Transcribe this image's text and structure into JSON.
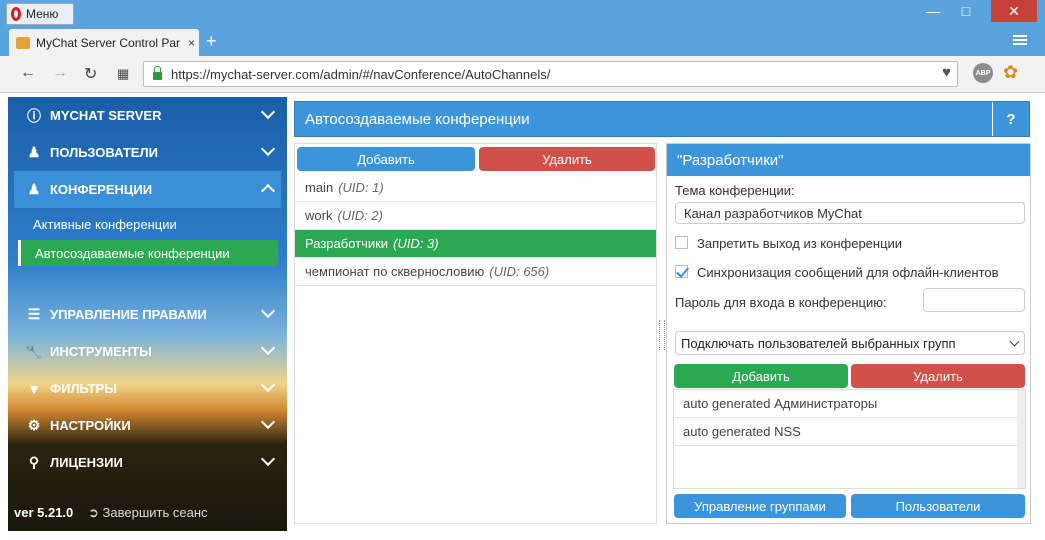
{
  "browser": {
    "menu_label": "Меню",
    "tab_title": "MyChat Server Control Par",
    "tab_close": "×",
    "new_tab": "+",
    "url": "https://mychat-server.com/admin/#/navConference/AutoChannels/",
    "abp_label": "ABP"
  },
  "sidebar": {
    "items": [
      {
        "label": "MYCHAT SERVER",
        "icon": "info-icon"
      },
      {
        "label": "ПОЛЬЗОВАТЕЛИ",
        "icon": "users-icon"
      },
      {
        "label": "КОНФЕРЕНЦИИ",
        "icon": "users-icon"
      },
      {
        "label": "УПРАВЛЕНИЕ ПРАВАМИ",
        "icon": "list-icon"
      },
      {
        "label": "ИНСТРУМЕНТЫ",
        "icon": "wrench-icon"
      },
      {
        "label": "ФИЛЬТРЫ",
        "icon": "filter-icon"
      },
      {
        "label": "НАСТРОЙКИ",
        "icon": "gears-icon"
      },
      {
        "label": "ЛИЦЕНЗИИ",
        "icon": "key-icon"
      }
    ],
    "sub_items": [
      "Активные конференции",
      "Автосоздаваемые конференции"
    ],
    "version": "ver 5.21.0",
    "logout": "Завершить сеанс"
  },
  "header": {
    "title": "Автосоздаваемые конференции",
    "help": "?"
  },
  "conferences": {
    "add_label": "Добавить",
    "delete_label": "Удалить",
    "rows": [
      {
        "name": "main",
        "uid": "(UID: 1)"
      },
      {
        "name": "work",
        "uid": "(UID: 2)"
      },
      {
        "name": "Разработчики",
        "uid": "(UID: 3)"
      },
      {
        "name": "чемпионат по сквернословию",
        "uid": "(UID: 656)"
      }
    ]
  },
  "details": {
    "title": "\"Разработчики\"",
    "topic_label": "Тема конференции:",
    "topic_value": "Канал разработчиков MyChat",
    "no_exit_label": "Запретить выход из конференции",
    "no_exit_checked": false,
    "sync_label": "Синхронизация сообщений для офлайн-клиентов",
    "sync_checked": true,
    "password_label": "Пароль для входа в конференцию:",
    "password_value": "",
    "group_select": "Подключать пользователей выбранных групп",
    "add_label": "Добавить",
    "delete_label": "Удалить",
    "groups": [
      "auto generated Администраторы",
      "auto generated NSS"
    ],
    "manage_groups_label": "Управление группами",
    "users_label": "Пользователи"
  }
}
